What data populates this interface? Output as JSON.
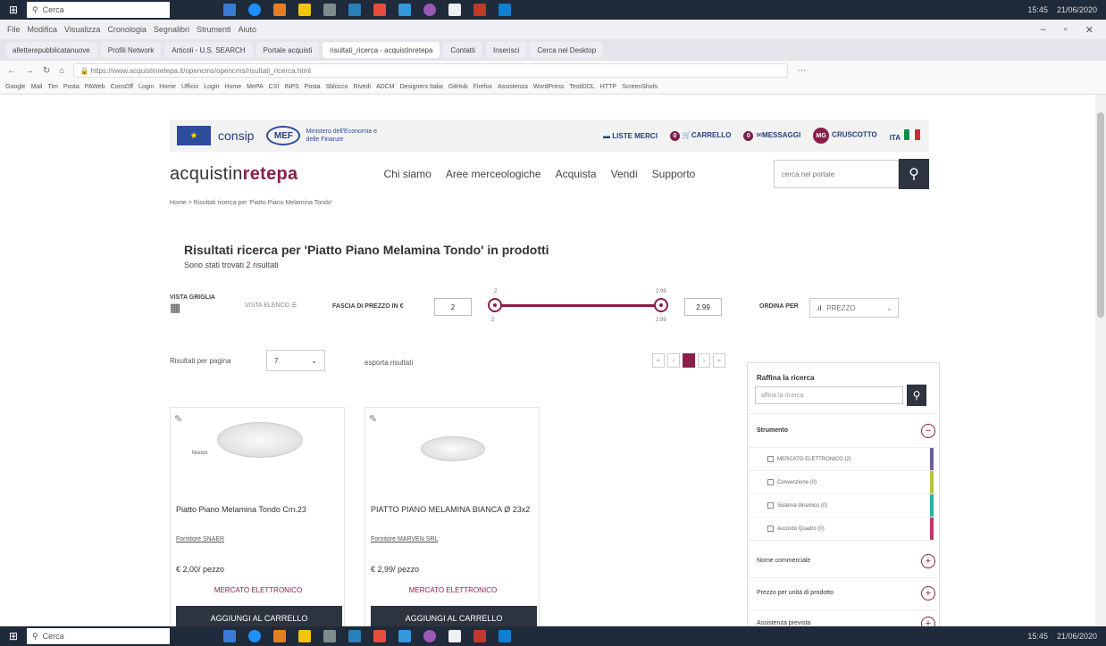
{
  "os": {
    "search_placeholder": "Cerca",
    "clock_time": "15:45",
    "clock_date": "21/06/2020"
  },
  "browser": {
    "menu": [
      "File",
      "Modifica",
      "Visualizza",
      "Cronologia",
      "Segnalibri",
      "Strumenti",
      "Aiuto"
    ],
    "tabs": [
      "alletterepubblicatanuove",
      "Profili Network",
      "Articoli - U.S. SEARCH",
      "Portale acquisti",
      "risultati_ricerca - acquistinretepa",
      "Contatti",
      "Inserisci",
      "Cerca nel Desktop"
    ],
    "url": "https://www.acquistinretepa.it/opencms/opencms/risultati_ricerca.html",
    "bookmarks": [
      "Google",
      "Mail",
      "Tim",
      "Posta",
      "PAWeb",
      "ConsOff",
      "Login",
      "Home",
      "Ufficio",
      "Login",
      "Home",
      "MePA",
      "CSI",
      "INPS",
      "Posta",
      "Sblocco",
      "Rivedi",
      "ADCM",
      "Designers Italia",
      "GitHub",
      "Firefox",
      "Assistenza",
      "WordPress",
      "TestiDDL",
      "HTTP",
      "ScreenShots"
    ]
  },
  "header": {
    "consip_label": "consip",
    "mef_label": "MEF",
    "mef_text": "Ministero dell'Economia e delle Finanze",
    "liste_merci": "LISTE MERCI",
    "carrello": "CARRELLO",
    "carrello_count": "0",
    "messaggi": "MESSAGGI",
    "messaggi_count": "0",
    "avatar": "MG",
    "cruscotto": "CRUSCOTTO",
    "lang": "ITA",
    "brand_prefix": "acquistin",
    "brand_mid": "rete",
    "brand_suffix": "pa",
    "nav": [
      "Chi siamo",
      "Aree merceologiche",
      "Acquista",
      "Vendi",
      "Supporto"
    ],
    "search_placeholder": "cerca nel portale",
    "breadcrumb": "Home > Risultati ricerca per 'Piatto Piano Melamina Tondo'"
  },
  "results": {
    "title": "Risultati ricerca per 'Piatto Piano Melamina Tondo' in prodotti",
    "sub_prefix": "Sono stati trovati ",
    "count": "2",
    "sub_suffix": " risultati"
  },
  "controls": {
    "grid_label": "VISTA GRIGLIA",
    "list_label": "VISTA ELENCO",
    "price_range_label": "FASCIA DI PREZZO IN €",
    "price_min": "2",
    "price_max": "2.99",
    "slider_min_top": "2",
    "slider_min_bottom": "2",
    "slider_max_top": "2.99",
    "slider_max_bottom": "2.99",
    "sort_label": "ORDINA PER",
    "sort_value": "PREZZO",
    "per_page_label": "Risultati per pagina",
    "per_page_value": "7",
    "export_label": "esporta risultati",
    "page_current": "1"
  },
  "products": [
    {
      "name": "Piatto Piano Melamina Tondo Cm.23",
      "supplier": "Fornitore SNAER",
      "price": "€ 2,00/ pezzo",
      "market": "MERCATO ELETTRONICO",
      "cart": "AGGIUNGI AL CARRELLO",
      "image_label": "Nuovo"
    },
    {
      "name": "PIATTO PIANO MELAMINA BIANCA Ø 23x2",
      "supplier": "Fornitore MARVEN SRL",
      "price": "€ 2,99/ pezzo",
      "market": "MERCATO ELETTRONICO",
      "cart": "AGGIUNGI AL CARRELLO"
    }
  ],
  "sidebar": {
    "title": "Raffina la ricerca",
    "search_placeholder": "affina la ricerca",
    "strumento": "Strumento",
    "options": [
      {
        "label": "MERCATO ELETTRONICO (2)",
        "color": "#6b5fa0"
      },
      {
        "label": "Convenzione (0)",
        "color": "#b6c13f"
      },
      {
        "label": "Sistema dinamico (0)",
        "color": "#2fb0a6"
      },
      {
        "label": "Accordo Quadro (0)",
        "color": "#c03866"
      }
    ],
    "nome_commerciale": "Nome commerciale",
    "prezzo_unita": "Prezzo per unità di prodotto",
    "assistenza": "Assistenza prevista"
  },
  "colors": {
    "brand_accent": "#8c1f4a",
    "dark_button": "#2d3440"
  }
}
